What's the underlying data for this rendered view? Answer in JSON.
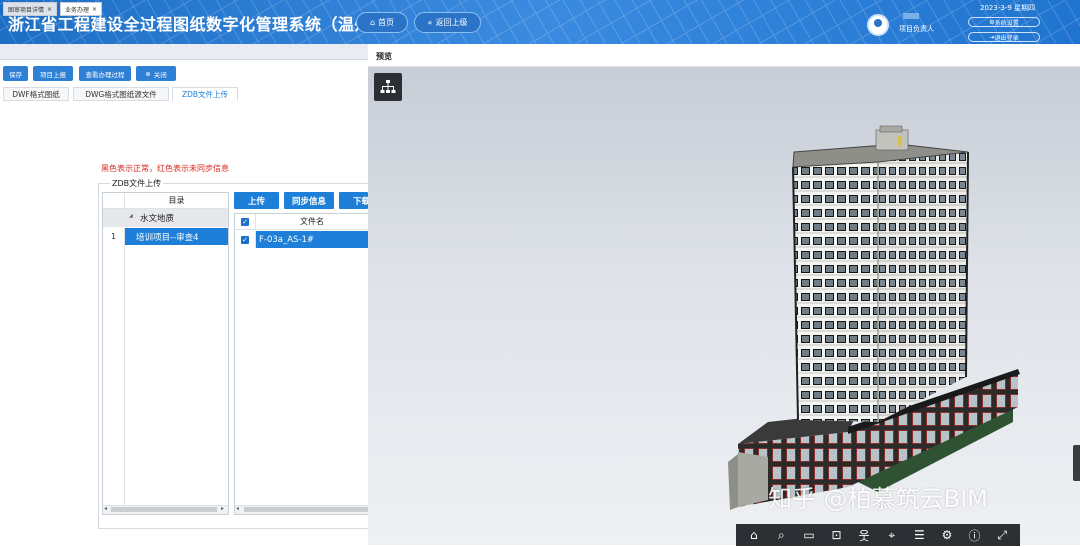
{
  "header": {
    "title": "浙江省工程建设全过程图纸数字化管理系统（温州）",
    "home_label": "首页",
    "back_label": "返回上级",
    "date": "2023-3-9 星期四",
    "user_role": "项目负责人",
    "settings_label": "系统设置",
    "logout_label": "退出登录"
  },
  "tabs": [
    {
      "label": "图审项目详情"
    },
    {
      "label": "业务办理"
    }
  ],
  "toolbar": {
    "save_label": "保存",
    "report_label": "项目上报",
    "history_label": "查看办理过程",
    "close_label": "关闭"
  },
  "subtabs": [
    {
      "label": "DWF格式图纸"
    },
    {
      "label": "DWG格式图纸源文件"
    },
    {
      "label": "ZDB文件上传"
    }
  ],
  "upload": {
    "note": "黑色表示正常，红色表示未同步信息",
    "legend": "ZDB文件上传",
    "dir_header": "目录",
    "group_name": "水文地质",
    "row_index": "1",
    "row_name": "培训项目--审查4",
    "upload_label": "上传",
    "sync_label": "同步信息",
    "download_label": "下载",
    "file_header": "文件名",
    "file_name": "F-03a_AS-1#"
  },
  "preview": {
    "title": "预览"
  },
  "watermark": "知乎 @柏慕筑云BIM",
  "icons": {
    "home": "home-icon",
    "tree": "tree-structure-icon",
    "settings": "gear-icon"
  },
  "colors": {
    "header_bg": "#2a7ddb",
    "primary": "#1e7fd8",
    "warning_text": "#d9261c",
    "selected_row": "#1e7fd8"
  }
}
